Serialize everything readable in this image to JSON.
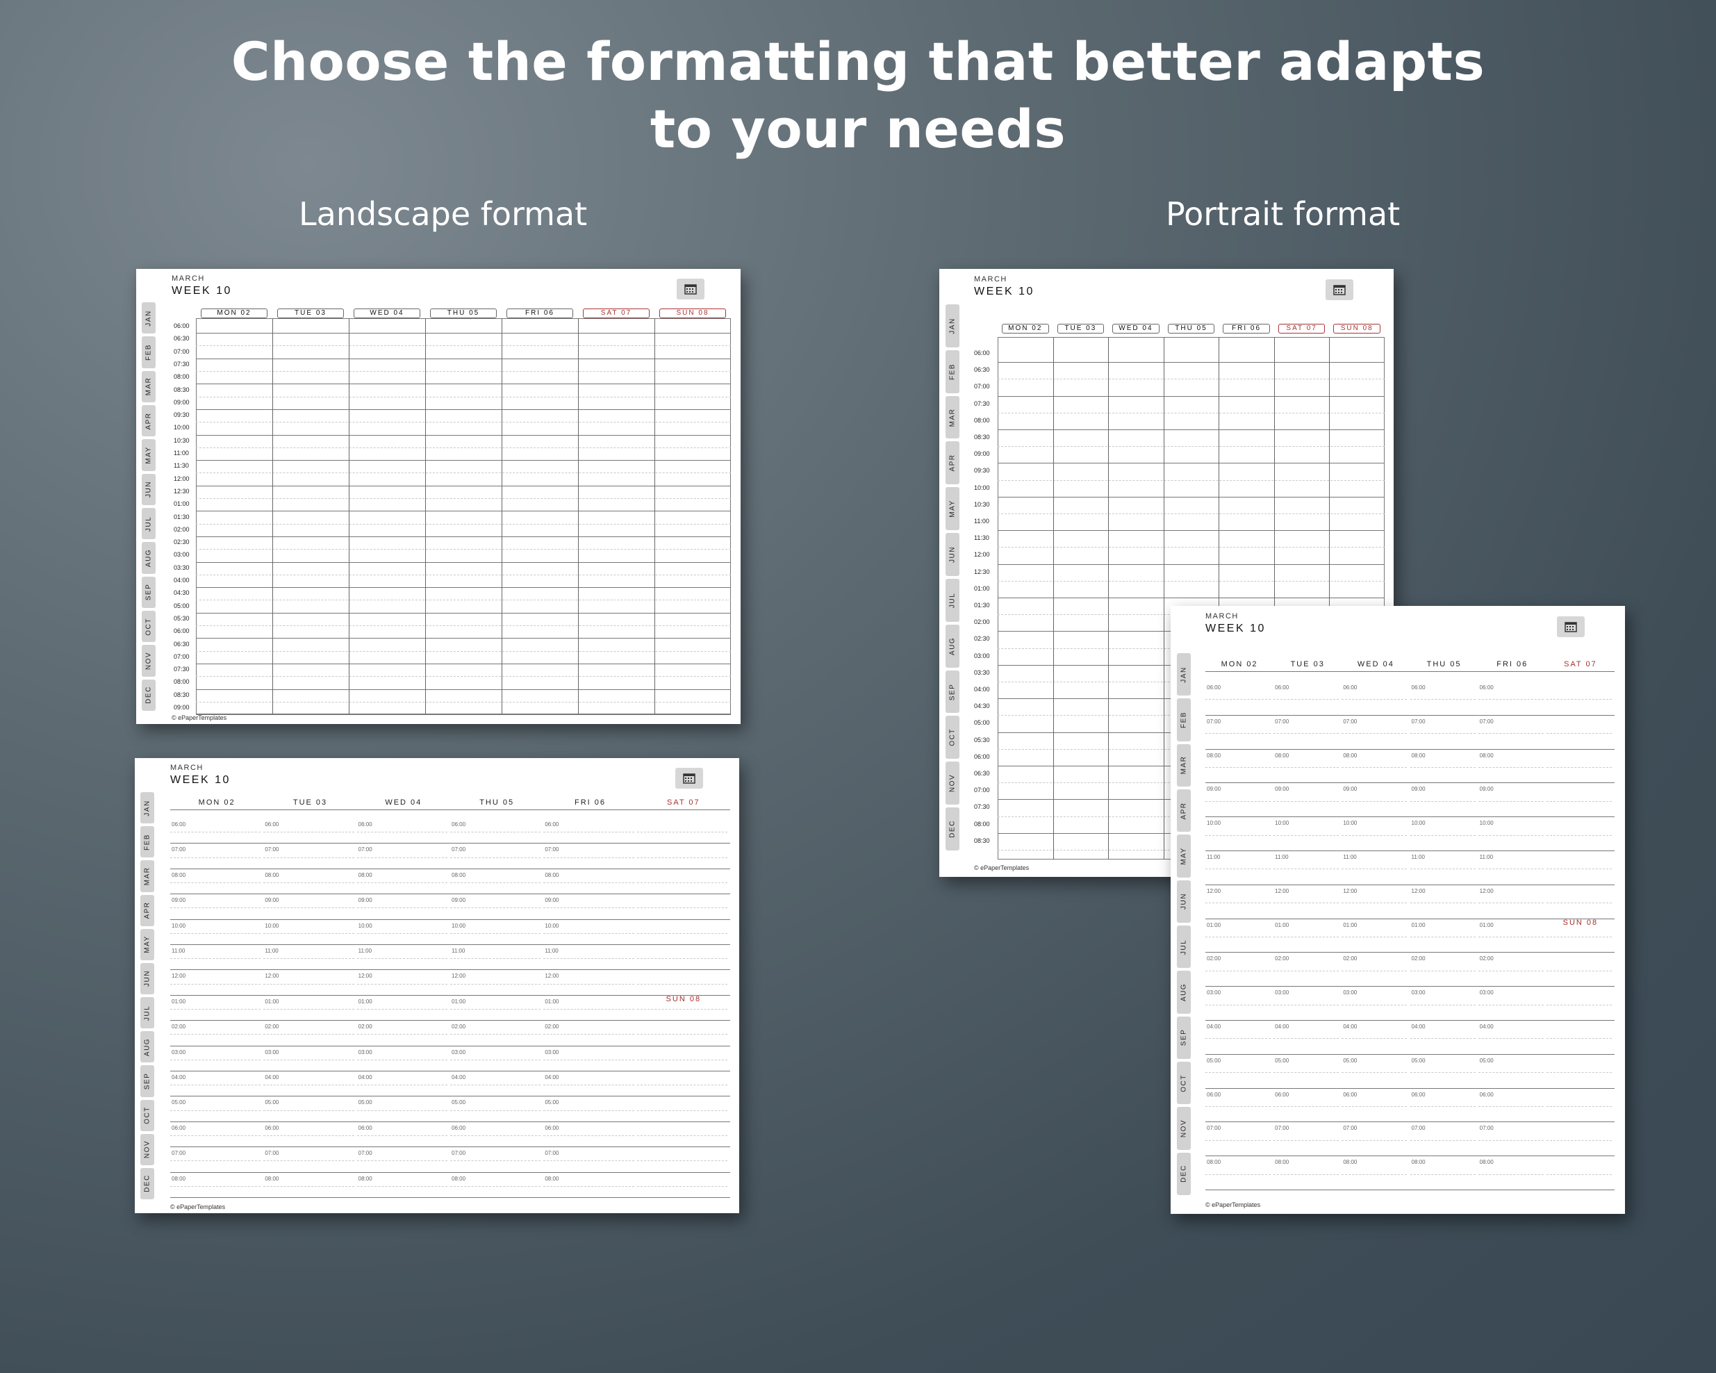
{
  "headline": {
    "line1": "Choose the formatting that better adapts",
    "line2": "to your needs"
  },
  "formats": {
    "landscape_label": "Landscape format",
    "portrait_label": "Portrait format"
  },
  "planner": {
    "month": "MARCH",
    "week": "WEEK 10",
    "calendar_icon": "calendar-icon",
    "footer": "© ePaperTemplates",
    "months": [
      "JAN",
      "FEB",
      "MAR",
      "APR",
      "MAY",
      "JUN",
      "JUL",
      "AUG",
      "SEP",
      "OCT",
      "NOV",
      "DEC"
    ],
    "days": [
      "MON 02",
      "TUE 03",
      "WED 04",
      "THU 05",
      "FRI 06",
      "SAT 07",
      "SUN 08"
    ],
    "weekend_days": [
      "SAT 07",
      "SUN 08"
    ],
    "half_hour_times_landscape": [
      "06:00",
      "06:30",
      "07:00",
      "07:30",
      "08:00",
      "08:30",
      "09:00",
      "09:30",
      "10:00",
      "10:30",
      "11:00",
      "11:30",
      "12:00",
      "12:30",
      "01:00",
      "01:30",
      "02:00",
      "02:30",
      "03:00",
      "03:30",
      "04:00",
      "04:30",
      "05:00",
      "05:30",
      "06:00",
      "06:30",
      "07:00",
      "07:30",
      "08:00",
      "08:30",
      "09:00"
    ],
    "half_hour_times_portrait": [
      "06:00",
      "06:30",
      "07:00",
      "07:30",
      "08:00",
      "08:30",
      "09:00",
      "09:30",
      "10:00",
      "10:30",
      "11:00",
      "11:30",
      "12:00",
      "12:30",
      "01:00",
      "01:30",
      "02:00",
      "02:30",
      "03:00",
      "03:30",
      "04:00",
      "04:30",
      "05:00",
      "05:30",
      "06:00",
      "06:30",
      "07:00",
      "07:30",
      "08:00",
      "08:30"
    ],
    "hourly_times": [
      "06:00",
      "07:00",
      "08:00",
      "09:00",
      "10:00",
      "11:00",
      "12:00",
      "01:00",
      "02:00",
      "03:00",
      "04:00",
      "05:00",
      "06:00",
      "07:00",
      "08:00"
    ]
  },
  "colors": {
    "background": "#4b5963",
    "weekend_accent": "#a3302f",
    "tab_gray": "#d2d2d2"
  }
}
